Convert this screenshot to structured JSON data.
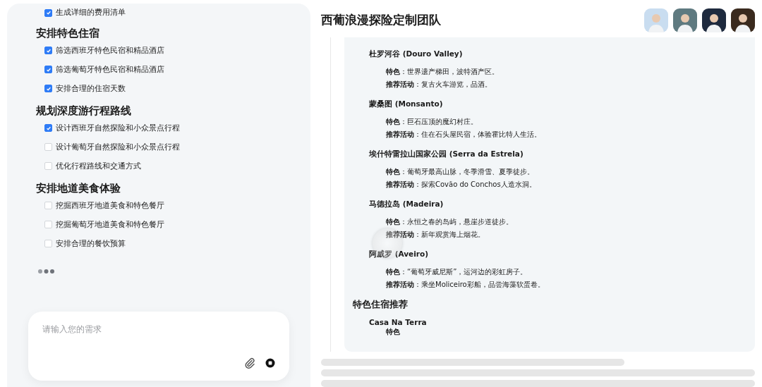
{
  "left": {
    "top_items": [
      {
        "label": "生成详细的费用清单",
        "checked": true
      }
    ],
    "sections": [
      {
        "title": "安排特色住宿",
        "items": [
          {
            "label": "筛选西班牙特色民宿和精品酒店",
            "checked": true
          },
          {
            "label": "筛选葡萄牙特色民宿和精品酒店",
            "checked": true
          },
          {
            "label": "安排合理的住宿天数",
            "checked": true
          }
        ]
      },
      {
        "title": "规划深度游行程路线",
        "items": [
          {
            "label": "设计西班牙自然探险和小众景点行程",
            "checked": true
          },
          {
            "label": "设计葡萄牙自然探险和小众景点行程",
            "checked": false
          },
          {
            "label": "优化行程路线和交通方式",
            "checked": false
          }
        ]
      },
      {
        "title": "安排地道美食体验",
        "items": [
          {
            "label": "挖掘西班牙地道美食和特色餐厅",
            "checked": false
          },
          {
            "label": "挖掘葡萄牙地道美食和特色餐厅",
            "checked": false
          },
          {
            "label": "安排合理的餐饮预算",
            "checked": false
          }
        ]
      }
    ],
    "input": {
      "placeholder": "请输入您的需求"
    }
  },
  "right": {
    "title": "西葡浪漫探险定制团队",
    "avatars": [
      {
        "color": "#c9ddf0"
      },
      {
        "color": "#5f7a80"
      },
      {
        "color": "#1e2a3e"
      },
      {
        "color": "#3a2a1e"
      }
    ],
    "places": [
      {
        "name": "杜罗河谷 (Douro Valley)",
        "feature": "**特色**：世界遗产梯田，波特酒产区。",
        "activity": "**推荐活动**：复古火车游览，品酒。"
      },
      {
        "name": "蒙桑图 (Monsanto)",
        "feature": "**特色**：巨石压顶的魔幻村庄。",
        "activity": "**推荐活动**：住在石头屋民宿，体验霍比特人生活。"
      },
      {
        "name": "埃什特雷拉山国家公园 (Serra da Estrela)",
        "feature": "**特色**：葡萄牙最高山脉，冬季滑雪、夏季徒步。",
        "activity": "**推荐活动**：探索Covão do Conchos人造水洞。"
      },
      {
        "name": "马德拉岛 (Madeira)",
        "feature": "**特色**：永恒之春的岛屿，悬崖步道徒步。",
        "activity": "**推荐活动**：新年观赏海上烟花。"
      },
      {
        "name": "阿威罗 (Aveiro)",
        "feature": "**特色**：“葡萄牙威尼斯”，运河边的彩虹房子。",
        "activity": "**推荐活动**：乘坐Moliceiro彩船，品尝海藻软蛋卷。"
      }
    ],
    "lodging_heading": "特色住宿推荐",
    "lodgings": [
      {
        "name": "Casa Na Terra",
        "feature_label": "特色"
      }
    ]
  }
}
